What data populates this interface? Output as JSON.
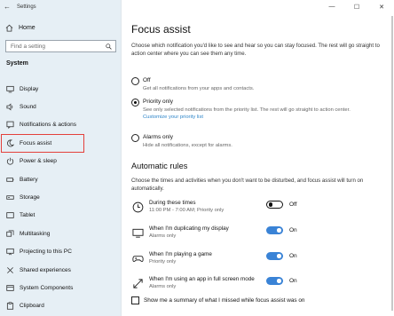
{
  "window": {
    "title": "Settings",
    "controls": {
      "minimize": "—",
      "maximize": "☐",
      "close": "✕"
    }
  },
  "sidebar": {
    "back_glyph": "←",
    "home_label": "Home",
    "search_placeholder": "Find a setting",
    "section_label": "System",
    "items": [
      {
        "label": "Display",
        "icon": "display-icon"
      },
      {
        "label": "Sound",
        "icon": "sound-icon"
      },
      {
        "label": "Notifications & actions",
        "icon": "notifications-icon"
      },
      {
        "label": "Focus assist",
        "icon": "moon-icon",
        "selected": true
      },
      {
        "label": "Power & sleep",
        "icon": "power-icon"
      },
      {
        "label": "Battery",
        "icon": "battery-icon"
      },
      {
        "label": "Storage",
        "icon": "storage-icon"
      },
      {
        "label": "Tablet",
        "icon": "tablet-icon"
      },
      {
        "label": "Multitasking",
        "icon": "multitasking-icon"
      },
      {
        "label": "Projecting to this PC",
        "icon": "projecting-icon"
      },
      {
        "label": "Shared experiences",
        "icon": "shared-experiences-icon"
      },
      {
        "label": "System Components",
        "icon": "system-components-icon"
      },
      {
        "label": "Clipboard",
        "icon": "clipboard-icon"
      }
    ]
  },
  "main": {
    "title": "Focus assist",
    "description": "Choose which notification you'd like to see and hear so you can stay focused. The rest will go straight to action center where you can see them any time.",
    "options": [
      {
        "label": "Off",
        "sub": "Get all notifications from your apps and contacts.",
        "checked": false
      },
      {
        "label": "Priority only",
        "sub": "See only selected notifications from the priority list. The rest will go straight to action center.",
        "link": "Customize your priority list",
        "checked": true
      },
      {
        "label": "Alarms only",
        "sub": "Hide all notifications, except for alarms.",
        "checked": false
      }
    ],
    "automatic_rules": {
      "heading": "Automatic rules",
      "description": "Choose the times and activities when you don't want to be disturbed, and focus assist will turn on automatically.",
      "rules": [
        {
          "title": "During these times",
          "sub": "11:00 PM - 7:00 AM; Priority only",
          "state": "Off",
          "icon": "clock-icon"
        },
        {
          "title": "When I'm duplicating my display",
          "sub": "Alarms only",
          "state": "On",
          "icon": "monitor-icon"
        },
        {
          "title": "When I'm playing a game",
          "sub": "Priority only",
          "state": "On",
          "icon": "gamepad-icon"
        },
        {
          "title": "When I'm using an app in full screen mode",
          "sub": "Alarms only",
          "state": "On",
          "icon": "fullscreen-icon"
        }
      ]
    },
    "summary_checkbox_label": "Show me a summary of what I missed while focus assist was on"
  }
}
